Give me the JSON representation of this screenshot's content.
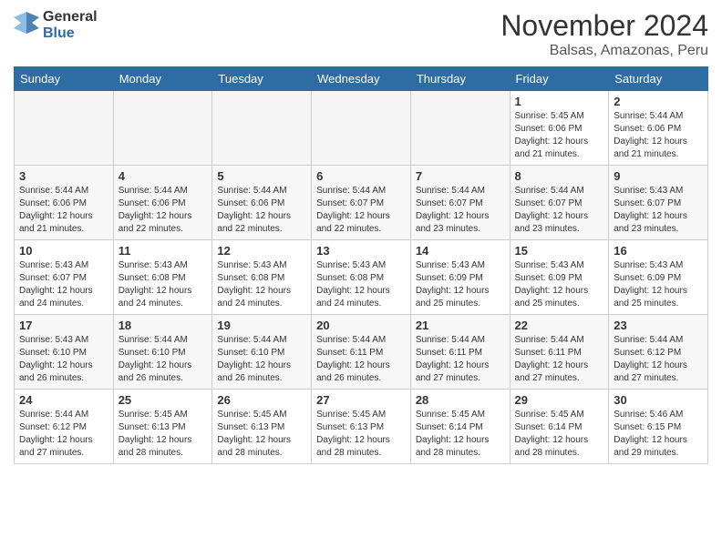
{
  "header": {
    "logo_general": "General",
    "logo_blue": "Blue",
    "month_title": "November 2024",
    "location": "Balsas, Amazonas, Peru"
  },
  "days_of_week": [
    "Sunday",
    "Monday",
    "Tuesday",
    "Wednesday",
    "Thursday",
    "Friday",
    "Saturday"
  ],
  "weeks": [
    [
      {
        "day": "",
        "info": ""
      },
      {
        "day": "",
        "info": ""
      },
      {
        "day": "",
        "info": ""
      },
      {
        "day": "",
        "info": ""
      },
      {
        "day": "",
        "info": ""
      },
      {
        "day": "1",
        "info": "Sunrise: 5:45 AM\nSunset: 6:06 PM\nDaylight: 12 hours and 21 minutes."
      },
      {
        "day": "2",
        "info": "Sunrise: 5:44 AM\nSunset: 6:06 PM\nDaylight: 12 hours and 21 minutes."
      }
    ],
    [
      {
        "day": "3",
        "info": "Sunrise: 5:44 AM\nSunset: 6:06 PM\nDaylight: 12 hours and 21 minutes."
      },
      {
        "day": "4",
        "info": "Sunrise: 5:44 AM\nSunset: 6:06 PM\nDaylight: 12 hours and 22 minutes."
      },
      {
        "day": "5",
        "info": "Sunrise: 5:44 AM\nSunset: 6:06 PM\nDaylight: 12 hours and 22 minutes."
      },
      {
        "day": "6",
        "info": "Sunrise: 5:44 AM\nSunset: 6:07 PM\nDaylight: 12 hours and 22 minutes."
      },
      {
        "day": "7",
        "info": "Sunrise: 5:44 AM\nSunset: 6:07 PM\nDaylight: 12 hours and 23 minutes."
      },
      {
        "day": "8",
        "info": "Sunrise: 5:44 AM\nSunset: 6:07 PM\nDaylight: 12 hours and 23 minutes."
      },
      {
        "day": "9",
        "info": "Sunrise: 5:43 AM\nSunset: 6:07 PM\nDaylight: 12 hours and 23 minutes."
      }
    ],
    [
      {
        "day": "10",
        "info": "Sunrise: 5:43 AM\nSunset: 6:07 PM\nDaylight: 12 hours and 24 minutes."
      },
      {
        "day": "11",
        "info": "Sunrise: 5:43 AM\nSunset: 6:08 PM\nDaylight: 12 hours and 24 minutes."
      },
      {
        "day": "12",
        "info": "Sunrise: 5:43 AM\nSunset: 6:08 PM\nDaylight: 12 hours and 24 minutes."
      },
      {
        "day": "13",
        "info": "Sunrise: 5:43 AM\nSunset: 6:08 PM\nDaylight: 12 hours and 24 minutes."
      },
      {
        "day": "14",
        "info": "Sunrise: 5:43 AM\nSunset: 6:09 PM\nDaylight: 12 hours and 25 minutes."
      },
      {
        "day": "15",
        "info": "Sunrise: 5:43 AM\nSunset: 6:09 PM\nDaylight: 12 hours and 25 minutes."
      },
      {
        "day": "16",
        "info": "Sunrise: 5:43 AM\nSunset: 6:09 PM\nDaylight: 12 hours and 25 minutes."
      }
    ],
    [
      {
        "day": "17",
        "info": "Sunrise: 5:43 AM\nSunset: 6:10 PM\nDaylight: 12 hours and 26 minutes."
      },
      {
        "day": "18",
        "info": "Sunrise: 5:44 AM\nSunset: 6:10 PM\nDaylight: 12 hours and 26 minutes."
      },
      {
        "day": "19",
        "info": "Sunrise: 5:44 AM\nSunset: 6:10 PM\nDaylight: 12 hours and 26 minutes."
      },
      {
        "day": "20",
        "info": "Sunrise: 5:44 AM\nSunset: 6:11 PM\nDaylight: 12 hours and 26 minutes."
      },
      {
        "day": "21",
        "info": "Sunrise: 5:44 AM\nSunset: 6:11 PM\nDaylight: 12 hours and 27 minutes."
      },
      {
        "day": "22",
        "info": "Sunrise: 5:44 AM\nSunset: 6:11 PM\nDaylight: 12 hours and 27 minutes."
      },
      {
        "day": "23",
        "info": "Sunrise: 5:44 AM\nSunset: 6:12 PM\nDaylight: 12 hours and 27 minutes."
      }
    ],
    [
      {
        "day": "24",
        "info": "Sunrise: 5:44 AM\nSunset: 6:12 PM\nDaylight: 12 hours and 27 minutes."
      },
      {
        "day": "25",
        "info": "Sunrise: 5:45 AM\nSunset: 6:13 PM\nDaylight: 12 hours and 28 minutes."
      },
      {
        "day": "26",
        "info": "Sunrise: 5:45 AM\nSunset: 6:13 PM\nDaylight: 12 hours and 28 minutes."
      },
      {
        "day": "27",
        "info": "Sunrise: 5:45 AM\nSunset: 6:13 PM\nDaylight: 12 hours and 28 minutes."
      },
      {
        "day": "28",
        "info": "Sunrise: 5:45 AM\nSunset: 6:14 PM\nDaylight: 12 hours and 28 minutes."
      },
      {
        "day": "29",
        "info": "Sunrise: 5:45 AM\nSunset: 6:14 PM\nDaylight: 12 hours and 28 minutes."
      },
      {
        "day": "30",
        "info": "Sunrise: 5:46 AM\nSunset: 6:15 PM\nDaylight: 12 hours and 29 minutes."
      }
    ]
  ]
}
